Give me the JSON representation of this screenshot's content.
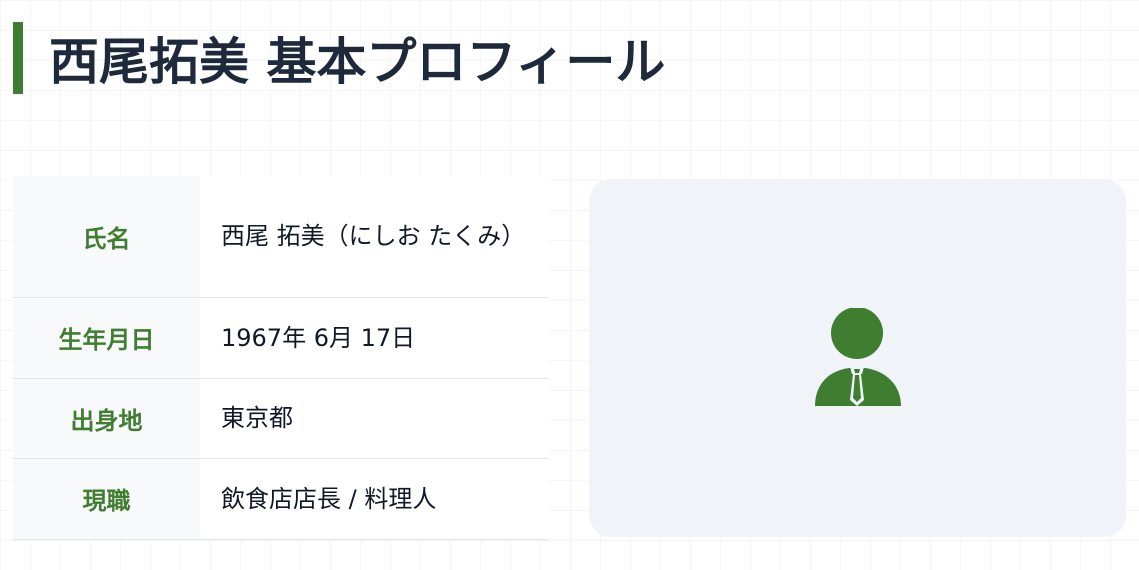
{
  "header": {
    "title": "西尾拓美 基本プロフィール"
  },
  "profile": {
    "rows": [
      {
        "label": "氏名",
        "value": "西尾 拓美（にしお たくみ）"
      },
      {
        "label": "生年月日",
        "value": "1967年 6月 17日"
      },
      {
        "label": "出身地",
        "value": "東京都"
      },
      {
        "label": "現職",
        "value": "飲食店店長 / 料理人"
      }
    ]
  },
  "photo": {
    "icon": "user-tie-icon"
  },
  "colors": {
    "accent": "#3f7d30",
    "title": "#1e293b",
    "panel": "#f0f3f7"
  }
}
